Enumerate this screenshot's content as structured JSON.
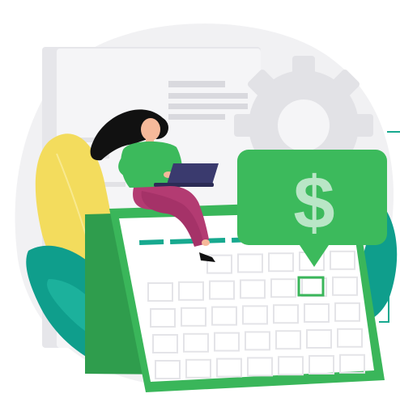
{
  "illustration": {
    "currency_symbol": "$",
    "colors": {
      "blob_background": "#f1f1f3",
      "paper": "#f5f5f7",
      "paper_shadow": "#e6e6ea",
      "paper_lines": "#d9d9de",
      "gear": "#e2e2e6",
      "calendar_green": "#3ab65a",
      "calendar_green_dark": "#2f9d4d",
      "calendar_face": "#ffffff",
      "calendar_cell": "#e4e4e8",
      "highlight_cell": "#3ab65a",
      "bubble_green": "#3cba5c",
      "dollar_fill": "#b9e6c6",
      "leaf_yellow": "#f3dc5d",
      "leaf_teal": "#0f9e8c",
      "leaf_teal_light": "#1cb19c",
      "hair": "#111111",
      "skin": "#f6b99a",
      "shirt": "#3cba5c",
      "pants": "#b33b72",
      "laptop": "#3a3a6e",
      "accent_lines": "#17a98f"
    }
  }
}
